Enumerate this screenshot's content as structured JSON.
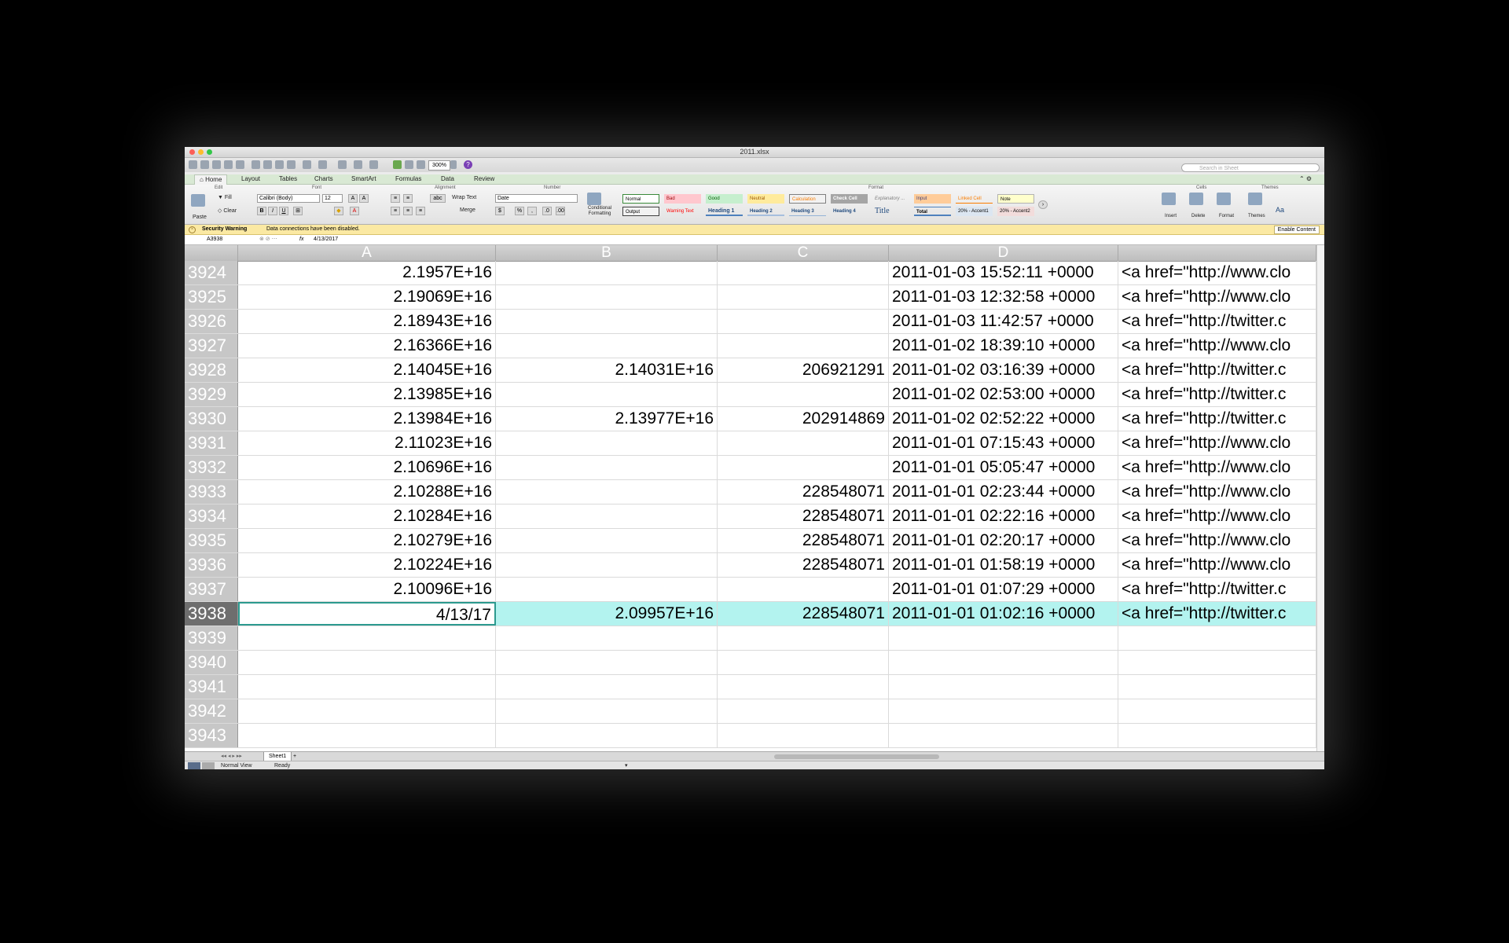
{
  "window": {
    "title": "2011.xlsx"
  },
  "ribbon": {
    "tabs": [
      "Home",
      "Layout",
      "Tables",
      "Charts",
      "SmartArt",
      "Formulas",
      "Data",
      "Review"
    ],
    "groups": {
      "edit": "Edit",
      "font": "Font",
      "alignment": "Alignment",
      "number": "Number",
      "format": "Format",
      "cells": "Cells",
      "themes": "Themes"
    },
    "paste": "Paste",
    "fill": "Fill",
    "clear": "Clear",
    "font_name": "Calibri (Body)",
    "font_size": "12",
    "wrap_text": "Wrap Text",
    "merge": "Merge",
    "number_format": "Date",
    "conditional_formatting": "Conditional Formatting",
    "styles": [
      "Normal",
      "Bad",
      "Good",
      "Neutral",
      "Calculation",
      "Check Cell",
      "Explanatory ...",
      "Input",
      "Linked Cell",
      "Note",
      "Output",
      "Warning Text",
      "Heading 1",
      "Heading 2",
      "Heading 3",
      "Heading 4",
      "Title",
      "Total",
      "20% - Accent1",
      "20% - Accent2"
    ],
    "cells_buttons": [
      "Insert",
      "Delete",
      "Format"
    ],
    "themes_label": "Themes",
    "aa": "Aa",
    "zoom": "300%",
    "search_placeholder": "Search in Sheet"
  },
  "security": {
    "title": "Security Warning",
    "message": "Data connections have been disabled.",
    "button": "Enable Content"
  },
  "formula_bar": {
    "name_box": "A3938",
    "fx": "fx",
    "value": "4/13/2017"
  },
  "columns": [
    "A",
    "B",
    "C",
    "D",
    ""
  ],
  "rows": [
    {
      "n": "3924",
      "a": "2.1957E+16",
      "b": "",
      "c": "",
      "d": "2011-01-03 15:52:11 +0000",
      "e": "<a href=\"http://www.clo"
    },
    {
      "n": "3925",
      "a": "2.19069E+16",
      "b": "",
      "c": "",
      "d": "2011-01-03 12:32:58 +0000",
      "e": "<a href=\"http://www.clo"
    },
    {
      "n": "3926",
      "a": "2.18943E+16",
      "b": "",
      "c": "",
      "d": "2011-01-03 11:42:57 +0000",
      "e": "<a href=\"http://twitter.c"
    },
    {
      "n": "3927",
      "a": "2.16366E+16",
      "b": "",
      "c": "",
      "d": "2011-01-02 18:39:10 +0000",
      "e": "<a href=\"http://www.clo"
    },
    {
      "n": "3928",
      "a": "2.14045E+16",
      "b": "2.14031E+16",
      "c": "206921291",
      "d": "2011-01-02 03:16:39 +0000",
      "e": "<a href=\"http://twitter.c"
    },
    {
      "n": "3929",
      "a": "2.13985E+16",
      "b": "",
      "c": "",
      "d": "2011-01-02 02:53:00 +0000",
      "e": "<a href=\"http://twitter.c"
    },
    {
      "n": "3930",
      "a": "2.13984E+16",
      "b": "2.13977E+16",
      "c": "202914869",
      "d": "2011-01-02 02:52:22 +0000",
      "e": "<a href=\"http://twitter.c"
    },
    {
      "n": "3931",
      "a": "2.11023E+16",
      "b": "",
      "c": "",
      "d": "2011-01-01 07:15:43 +0000",
      "e": "<a href=\"http://www.clo"
    },
    {
      "n": "3932",
      "a": "2.10696E+16",
      "b": "",
      "c": "",
      "d": "2011-01-01 05:05:47 +0000",
      "e": "<a href=\"http://www.clo"
    },
    {
      "n": "3933",
      "a": "2.10288E+16",
      "b": "",
      "c": "228548071",
      "d": "2011-01-01 02:23:44 +0000",
      "e": "<a href=\"http://www.clo"
    },
    {
      "n": "3934",
      "a": "2.10284E+16",
      "b": "",
      "c": "228548071",
      "d": "2011-01-01 02:22:16 +0000",
      "e": "<a href=\"http://www.clo"
    },
    {
      "n": "3935",
      "a": "2.10279E+16",
      "b": "",
      "c": "228548071",
      "d": "2011-01-01 02:20:17 +0000",
      "e": "<a href=\"http://www.clo"
    },
    {
      "n": "3936",
      "a": "2.10224E+16",
      "b": "",
      "c": "228548071",
      "d": "2011-01-01 01:58:19 +0000",
      "e": "<a href=\"http://www.clo"
    },
    {
      "n": "3937",
      "a": "2.10096E+16",
      "b": "",
      "c": "",
      "d": "2011-01-01 01:07:29 +0000",
      "e": "<a href=\"http://twitter.c"
    },
    {
      "n": "3938",
      "a": "4/13/17",
      "b": "2.09957E+16",
      "c": "228548071",
      "d": "2011-01-01 01:02:16 +0000",
      "e": "<a href=\"http://twitter.c",
      "selected": true
    },
    {
      "n": "3939",
      "a": "",
      "b": "",
      "c": "",
      "d": "",
      "e": ""
    },
    {
      "n": "3940",
      "a": "",
      "b": "",
      "c": "",
      "d": "",
      "e": ""
    },
    {
      "n": "3941",
      "a": "",
      "b": "",
      "c": "",
      "d": "",
      "e": ""
    },
    {
      "n": "3942",
      "a": "",
      "b": "",
      "c": "",
      "d": "",
      "e": ""
    },
    {
      "n": "3943",
      "a": "",
      "b": "",
      "c": "",
      "d": "",
      "e": ""
    }
  ],
  "sheet_tabs": [
    "Sheet1"
  ],
  "status": {
    "view": "Normal View",
    "state": "Ready"
  },
  "colors": {
    "selected_row": "#b3f3ef",
    "ribbon_tabs_bg": "#d9e9d4",
    "security_bar": "#fbe9a3"
  }
}
